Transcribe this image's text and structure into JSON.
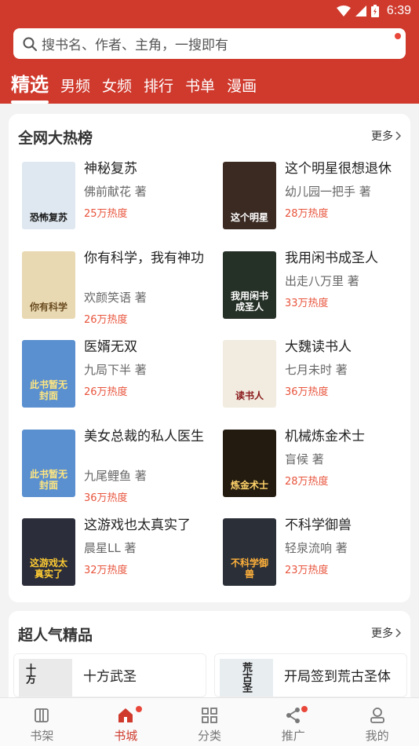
{
  "status": {
    "time": "6:39"
  },
  "search": {
    "placeholder": "搜书名、作者、主角，一搜即有"
  },
  "tabs": [
    {
      "label": "精选",
      "active": true
    },
    {
      "label": "男频"
    },
    {
      "label": "女频"
    },
    {
      "label": "排行"
    },
    {
      "label": "书单"
    },
    {
      "label": "漫画"
    }
  ],
  "hot": {
    "title": "全网大热榜",
    "more": "更多",
    "books": [
      {
        "title": "神秘复苏",
        "author": "佛前献花 著",
        "heat": "25万热度"
      },
      {
        "title": "这个明星很想退休",
        "author": "幼儿园一把手 著",
        "heat": "28万热度"
      },
      {
        "title": "你有科学，我有神功",
        "author": "欢颜笑语 著",
        "heat": "26万热度"
      },
      {
        "title": "我用闲书成圣人",
        "author": "出走八万里 著",
        "heat": "33万热度"
      },
      {
        "title": "医婿无双",
        "author": "九局下半 著",
        "heat": "26万热度"
      },
      {
        "title": "大魏读书人",
        "author": "七月未时 著",
        "heat": "36万热度"
      },
      {
        "title": "美女总裁的私人医生",
        "author": "九尾鲤鱼 著",
        "heat": "36万热度"
      },
      {
        "title": "机械炼金术士",
        "author": "盲候 著",
        "heat": "28万热度"
      },
      {
        "title": "这游戏也太真实了",
        "author": "晨星LL 著",
        "heat": "32万热度"
      },
      {
        "title": "不科学御兽",
        "author": "轻泉流响 著",
        "heat": "23万热度"
      }
    ],
    "covers": [
      {
        "text": "恐怖复苏",
        "bg": "#dfe8f0",
        "fg": "#1a1a1a"
      },
      {
        "text": "这个明星",
        "bg": "#3a2a22",
        "fg": "#ffffff"
      },
      {
        "text": "你有科学",
        "bg": "#e9d9b3",
        "fg": "#6a4b1f"
      },
      {
        "text": "我用闲书成圣人",
        "bg": "#253026",
        "fg": "#ffffff"
      },
      {
        "text": "此书暂无封面",
        "bg": "#5a8fd0",
        "fg": "#ffe680"
      },
      {
        "text": "读书人",
        "bg": "#f1ebe0",
        "fg": "#8a1b1b"
      },
      {
        "text": "此书暂无封面",
        "bg": "#5a8fd0",
        "fg": "#ffe680"
      },
      {
        "text": "炼金术士",
        "bg": "#231b10",
        "fg": "#ffd36b"
      },
      {
        "text": "这游戏太真实了",
        "bg": "#2b2d3a",
        "fg": "#ffcc33"
      },
      {
        "text": "不科学御兽",
        "bg": "#2a2f38",
        "fg": "#ffb13a"
      }
    ]
  },
  "popular": {
    "title": "超人气精品",
    "more": "更多",
    "books": [
      {
        "title": "十方武圣",
        "cover_text": "十方",
        "bg": "#eaeaea",
        "fg": "#222"
      },
      {
        "title": "开局签到荒古圣体",
        "cover_text": "荒古圣",
        "bg": "#e8edf0",
        "fg": "#222"
      }
    ]
  },
  "nav": [
    {
      "label": "书架",
      "icon": "bookshelf-icon"
    },
    {
      "label": "书城",
      "icon": "store-icon",
      "active": true,
      "dot": true
    },
    {
      "label": "分类",
      "icon": "category-icon"
    },
    {
      "label": "推广",
      "icon": "share-icon",
      "dot": true
    },
    {
      "label": "我的",
      "icon": "profile-icon"
    }
  ],
  "colors": {
    "brand": "#cf3a2d",
    "heat": "#e8543c"
  }
}
